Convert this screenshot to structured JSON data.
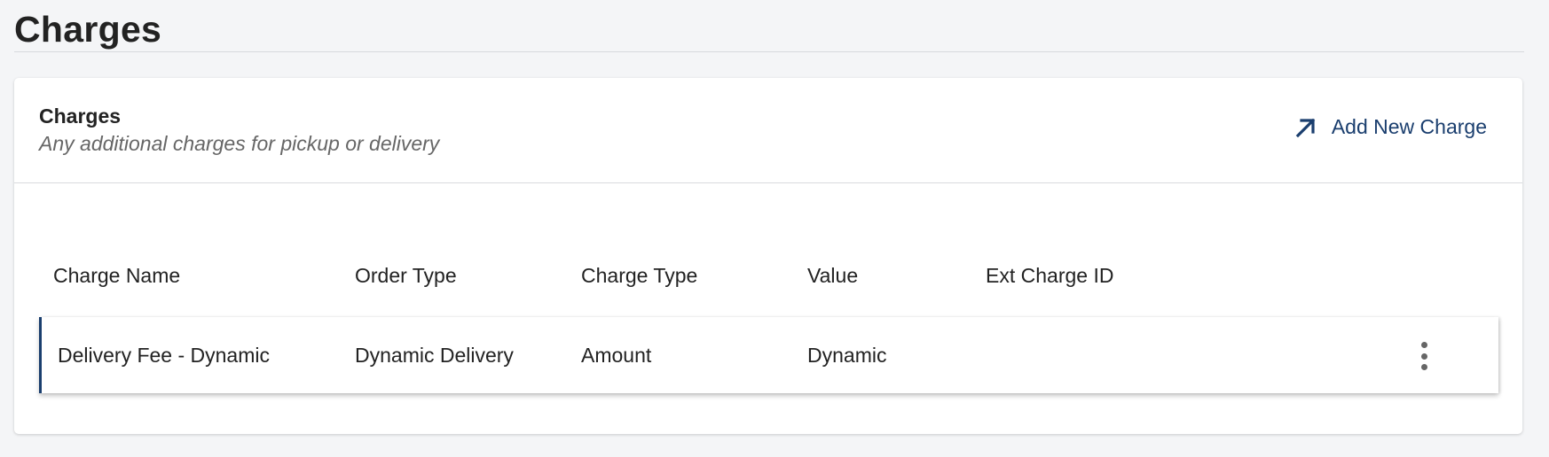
{
  "page": {
    "title": "Charges"
  },
  "card": {
    "title": "Charges",
    "subtitle": "Any additional charges for pickup or delivery",
    "add_button": {
      "label": "Add New Charge",
      "icon": "arrow-up-right-icon"
    }
  },
  "table": {
    "columns": [
      "Charge Name",
      "Order Type",
      "Charge Type",
      "Value",
      "Ext Charge ID"
    ],
    "rows": [
      {
        "charge_name": "Delivery Fee - Dynamic",
        "order_type": "Dynamic Delivery",
        "charge_type": "Amount",
        "value": "Dynamic",
        "ext_charge_id": "",
        "menu_icon": "more-vertical-icon"
      }
    ]
  },
  "colors": {
    "accent": "#1a3e6e",
    "background": "#f4f5f7",
    "card": "#ffffff",
    "subtle_text": "#666666"
  }
}
